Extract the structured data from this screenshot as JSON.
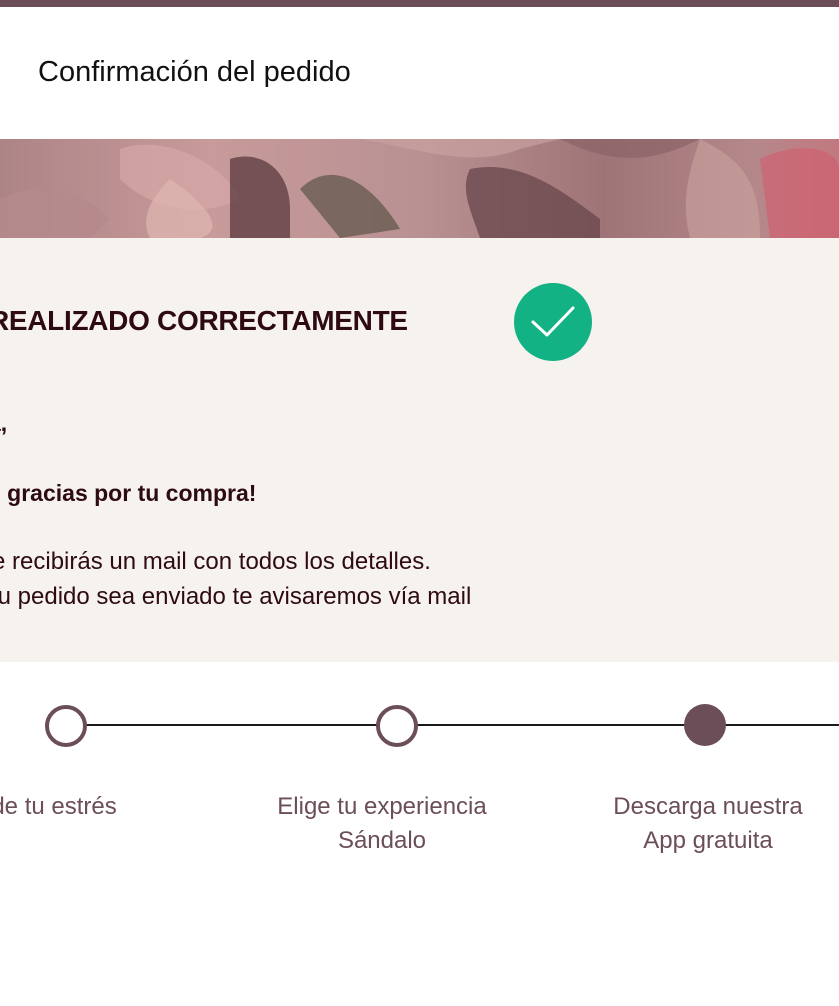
{
  "header": {
    "title": "Confirmación del pedido"
  },
  "confirmation": {
    "status_text": "O REALIZADO CORRECTAMENTE",
    "status_icon": "check-icon",
    "status_color": "#13b284",
    "greeting": "a,",
    "thanks": "s gracias por tu compra!",
    "detail_line_1": "e recibirás un mail con todos los detalles.",
    "detail_line_2": "tu pedido sea enviado te avisaremos vía mail"
  },
  "steps": [
    {
      "label_lines": [
        "ide tu estrés"
      ],
      "active": false
    },
    {
      "label_lines": [
        "Elige tu experiencia",
        "Sándalo"
      ],
      "active": false
    },
    {
      "label_lines": [
        "Descarga nuestra",
        "App gratuita"
      ],
      "active": true
    }
  ],
  "colors": {
    "accent": "#6b4e57",
    "text_dark": "#2e0b10",
    "panel_bg": "#f6f2ee",
    "success": "#13b284"
  }
}
